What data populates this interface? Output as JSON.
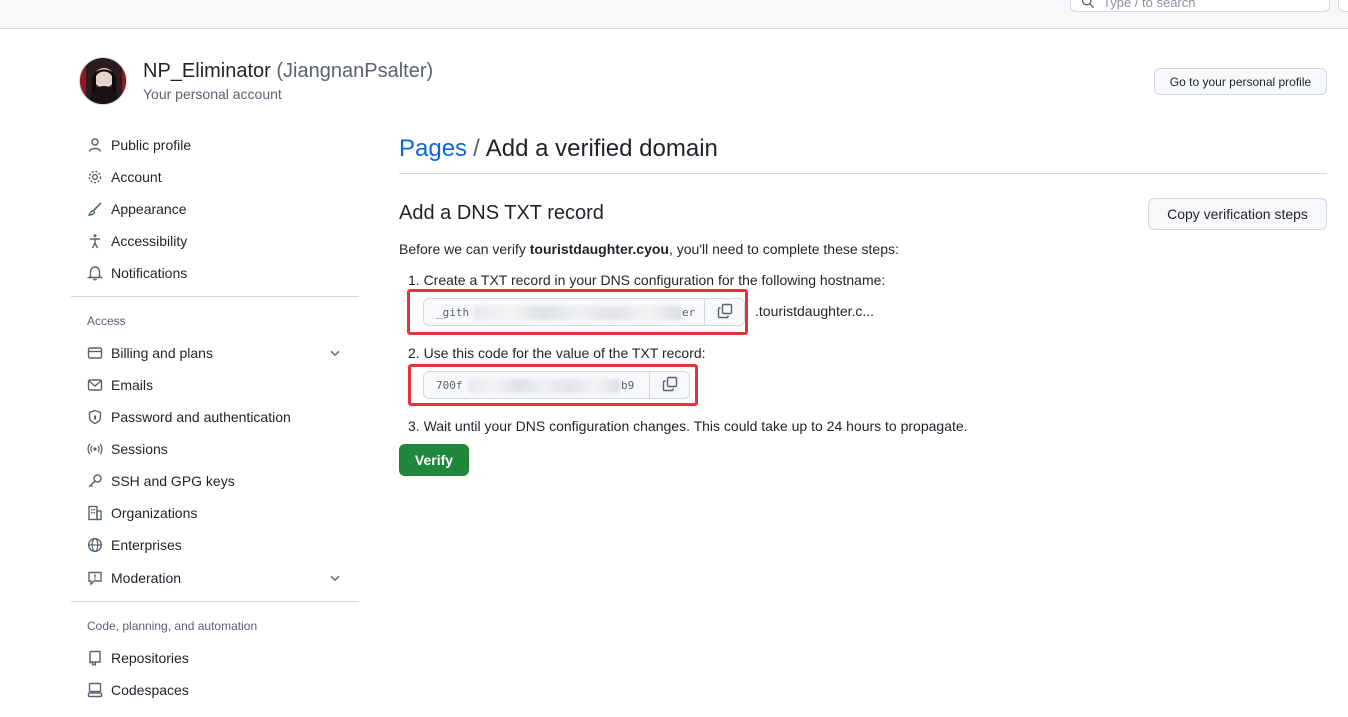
{
  "topbar": {
    "search_placeholder": "Type / to search",
    "search_icon": "search-icon"
  },
  "account": {
    "display_name": "NP_Eliminator",
    "login": "(JiangnanPsalter)",
    "subtitle": "Your personal account",
    "profile_button": "Go to your personal profile"
  },
  "sidebar": {
    "items": [
      {
        "label": "Public profile",
        "icon": "person-icon"
      },
      {
        "label": "Account",
        "icon": "gear-icon"
      },
      {
        "label": "Appearance",
        "icon": "paintbrush-icon"
      },
      {
        "label": "Accessibility",
        "icon": "accessibility-icon"
      },
      {
        "label": "Notifications",
        "icon": "bell-icon"
      }
    ],
    "access_heading": "Access",
    "access_items": [
      {
        "label": "Billing and plans",
        "icon": "credit-card-icon",
        "expandable": true
      },
      {
        "label": "Emails",
        "icon": "mail-icon"
      },
      {
        "label": "Password and authentication",
        "icon": "shield-lock-icon"
      },
      {
        "label": "Sessions",
        "icon": "broadcast-icon"
      },
      {
        "label": "SSH and GPG keys",
        "icon": "key-icon"
      },
      {
        "label": "Organizations",
        "icon": "organization-icon"
      },
      {
        "label": "Enterprises",
        "icon": "globe-icon"
      },
      {
        "label": "Moderation",
        "icon": "report-icon",
        "expandable": true
      }
    ],
    "code_heading": "Code, planning, and automation",
    "code_items": [
      {
        "label": "Repositories",
        "icon": "repo-icon"
      },
      {
        "label": "Codespaces",
        "icon": "codespaces-icon"
      }
    ]
  },
  "main": {
    "breadcrumb_parent": "Pages",
    "breadcrumb_sep": "/",
    "breadcrumb_current": "Add a verified domain",
    "section_title": "Add a DNS TXT record",
    "copy_steps_button": "Copy verification steps",
    "intro_prefix": "Before we can verify ",
    "domain": "touristdaughter.cyou",
    "intro_suffix": ", you'll need to complete these steps:",
    "step1": "1. Create a TXT record in your DNS configuration for the following hostname:",
    "hostname_start": "_gith",
    "hostname_end": "er",
    "hostname_suffix": ".touristdaughter.c...",
    "step2": "2. Use this code for the value of the TXT record:",
    "code_start": "700f",
    "code_end": "b9",
    "step3": "3. Wait until your DNS configuration changes. This could take up to 24 hours to propagate.",
    "verify_button": "Verify",
    "copy_icon": "copy-icon"
  },
  "colors": {
    "link": "#0969da",
    "verify_green": "#1f883d",
    "highlight_red": "#e5323b",
    "border": "#d0d7de"
  }
}
